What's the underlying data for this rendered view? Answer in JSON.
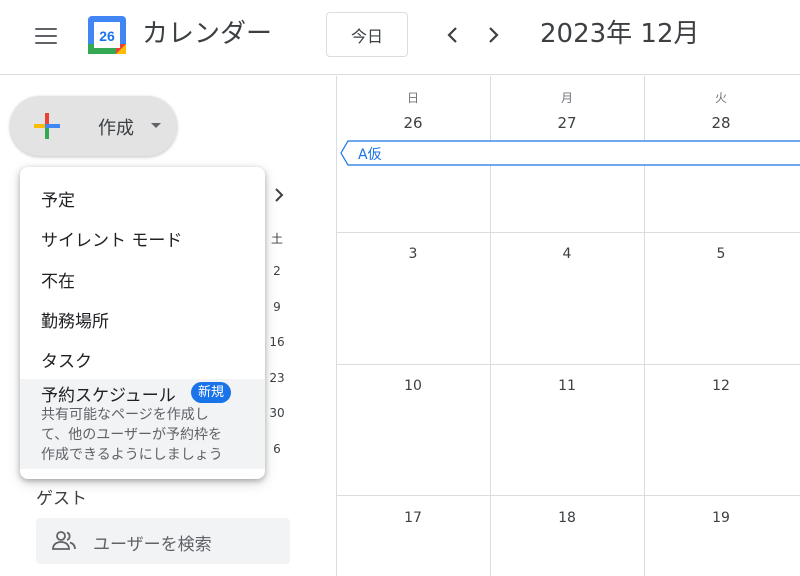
{
  "header": {
    "menu_icon": "hamburger-menu-icon",
    "logo_day": "26",
    "app_title": "カレンダー",
    "today_label": "今日",
    "prev_icon": "chevron-left-icon",
    "next_icon": "chevron-right-icon",
    "month_title": "2023年 12月"
  },
  "sidebar": {
    "create_label": "作成",
    "create_caret_icon": "caret-down-icon",
    "mini_calendar": {
      "weekday": "土",
      "dates": [
        "2",
        "9",
        "16",
        "23",
        "30",
        "6"
      ]
    },
    "guest_label": "ゲスト",
    "user_search_placeholder": "ユーザーを検索"
  },
  "dropdown": {
    "items": [
      "予定",
      "サイレント モード",
      "不在",
      "勤務場所",
      "タスク"
    ],
    "schedule": {
      "title": "予約スケジュール",
      "badge": "新規",
      "desc_lines": [
        "共有可能なページを作成し",
        "て、他のユーザーが予約枠を",
        "作成できるようにしましょう"
      ]
    }
  },
  "grid": {
    "days": [
      {
        "dow": "日",
        "date": "26"
      },
      {
        "dow": "月",
        "date": "27"
      },
      {
        "dow": "火",
        "date": "28"
      }
    ],
    "rows": [
      [
        "3",
        "4",
        "5"
      ],
      [
        "10",
        "11",
        "12"
      ],
      [
        "17",
        "18",
        "19"
      ]
    ],
    "event": {
      "label": "A仮"
    }
  },
  "colors": {
    "accent": "#1a73e8",
    "google_red": "#ea4335",
    "google_yellow": "#fbbc04",
    "google_green": "#34a853",
    "google_blue": "#4285f4"
  }
}
